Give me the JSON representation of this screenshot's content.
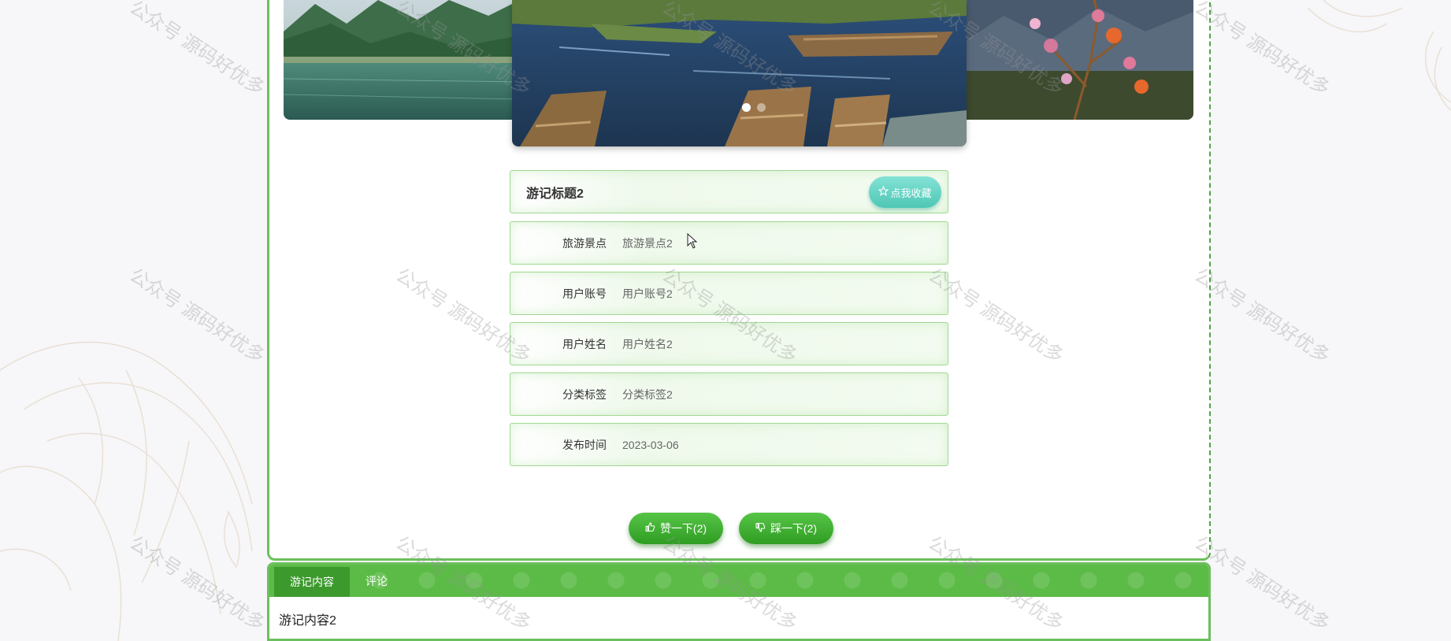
{
  "carousel": {
    "active_index": 0,
    "slide_count": 3
  },
  "detail": {
    "title": "游记标题2",
    "favorite_label": "点我收藏",
    "fields": [
      {
        "label": "旅游景点",
        "value": "旅游景点2"
      },
      {
        "label": "用户账号",
        "value": "用户账号2"
      },
      {
        "label": "用户姓名",
        "value": "用户姓名2"
      },
      {
        "label": "分类标签",
        "value": "分类标签2"
      },
      {
        "label": "发布时间",
        "value": "2023-03-06"
      }
    ]
  },
  "votes": {
    "like_label": "赞一下(2)",
    "dislike_label": "踩一下(2)"
  },
  "tabs": {
    "items": [
      "游记内容",
      "评论"
    ],
    "active": 0,
    "content": "游记内容2"
  },
  "watermark_text": "公众号 源码好优多",
  "colors": {
    "accent_green": "#5bbb46",
    "button_green": "#3a9d2c",
    "favorite_teal": "#5ccbbb",
    "row_border": "#9fd892"
  }
}
